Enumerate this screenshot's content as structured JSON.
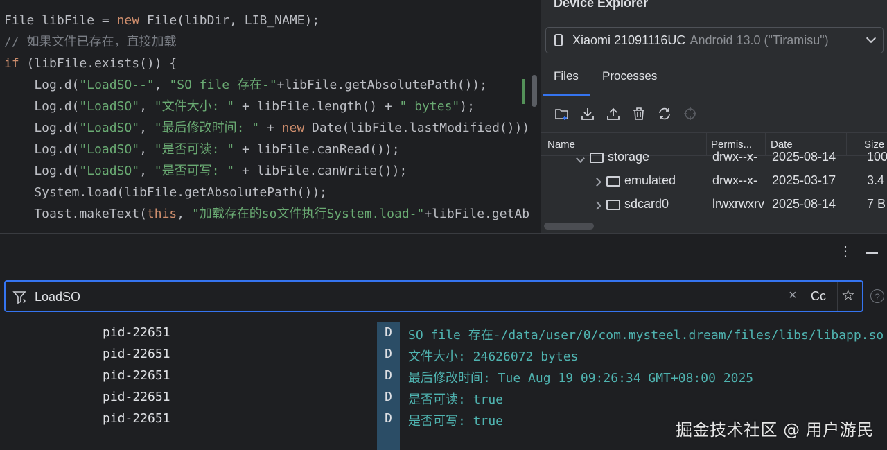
{
  "editor": {
    "lines": [
      [
        {
          "t": "File libFile = ",
          "c": "plain"
        },
        {
          "t": "new ",
          "c": "kw"
        },
        {
          "t": "File(libDir, LIB_NAME);",
          "c": "plain"
        }
      ],
      [
        {
          "t": "// 如果文件已存在，直接加载",
          "c": "cm"
        }
      ],
      [
        {
          "t": "if ",
          "c": "kw"
        },
        {
          "t": "(libFile.exists()) {",
          "c": "plain"
        }
      ],
      [
        {
          "t": "    Log.",
          "c": "plain"
        },
        {
          "t": "d",
          "c": "plain"
        },
        {
          "t": "(",
          "c": "plain"
        },
        {
          "t": "\"LoadSO--\"",
          "c": "str"
        },
        {
          "t": ", ",
          "c": "plain"
        },
        {
          "t": "\"SO file 存在-\"",
          "c": "str"
        },
        {
          "t": "+libFile.getAbsolutePath());",
          "c": "plain"
        }
      ],
      [
        {
          "t": "    Log.d(",
          "c": "plain"
        },
        {
          "t": "\"LoadSO\"",
          "c": "str"
        },
        {
          "t": ", ",
          "c": "plain"
        },
        {
          "t": "\"文件大小: \"",
          "c": "str"
        },
        {
          "t": " + libFile.length() + ",
          "c": "plain"
        },
        {
          "t": "\" bytes\"",
          "c": "str"
        },
        {
          "t": ");",
          "c": "plain"
        }
      ],
      [
        {
          "t": "    Log.d(",
          "c": "plain"
        },
        {
          "t": "\"LoadSO\"",
          "c": "str"
        },
        {
          "t": ", ",
          "c": "plain"
        },
        {
          "t": "\"最后修改时间: \"",
          "c": "str"
        },
        {
          "t": " + ",
          "c": "plain"
        },
        {
          "t": "new ",
          "c": "kw"
        },
        {
          "t": "Date(libFile.lastModified()))",
          "c": "plain"
        }
      ],
      [
        {
          "t": "    Log.d(",
          "c": "plain"
        },
        {
          "t": "\"LoadSO\"",
          "c": "str"
        },
        {
          "t": ", ",
          "c": "plain"
        },
        {
          "t": "\"是否可读: \"",
          "c": "str"
        },
        {
          "t": " + libFile.canRead());",
          "c": "plain"
        }
      ],
      [
        {
          "t": "    Log.d(",
          "c": "plain"
        },
        {
          "t": "\"LoadSO\"",
          "c": "str"
        },
        {
          "t": ", ",
          "c": "plain"
        },
        {
          "t": "\"是否可写: \"",
          "c": "str"
        },
        {
          "t": " + libFile.canWrite());",
          "c": "plain"
        }
      ],
      [
        {
          "t": "    System.load(libFile.getAbsolutePath());",
          "c": "plain"
        }
      ],
      [
        {
          "t": "    Toast.makeText(",
          "c": "plain"
        },
        {
          "t": "this",
          "c": "kw"
        },
        {
          "t": ", ",
          "c": "plain"
        },
        {
          "t": "\"加载存在的so文件执行System.load-\"",
          "c": "str"
        },
        {
          "t": "+libFile.getAb",
          "c": "plain"
        }
      ]
    ]
  },
  "device_explorer": {
    "title": "Device Explorer",
    "device_name": "Xiaomi 21091116UC",
    "device_version": "Android 13.0 (\"Tiramisu\")",
    "tabs": [
      "Files",
      "Processes"
    ],
    "active_tab": "Files",
    "toolbar_icons": [
      "new-folder-icon",
      "download-icon",
      "upload-icon",
      "delete-icon",
      "sync-icon",
      "locate-icon"
    ],
    "columns": [
      "Name",
      "Permis...",
      "Date",
      "Size"
    ],
    "rows": [
      {
        "name": "storage",
        "perm": "drwx--x-",
        "date": "2025-08-14",
        "size": "100",
        "expanded": true,
        "indent": 1
      },
      {
        "name": "emulated",
        "perm": "drwx--x-",
        "date": "2025-03-17",
        "size": "3.4 I",
        "expanded": false,
        "indent": 2
      },
      {
        "name": "sdcard0",
        "perm": "lrwxrwxrv",
        "date": "2025-08-14",
        "size": "7 B",
        "expanded": false,
        "indent": 2,
        "link": true
      }
    ]
  },
  "logcat": {
    "filter_value": "LoadSO",
    "match_case_label": "Cc",
    "help_label": "?",
    "rows": [
      {
        "pid": "pid-22651",
        "level": "D",
        "message": "SO file 存在-/data/user/0/com.mysteel.dream/files/libs/libapp.so"
      },
      {
        "pid": "pid-22651",
        "level": "D",
        "message": "文件大小: 24626072 bytes"
      },
      {
        "pid": "pid-22651",
        "level": "D",
        "message": "最后修改时间: Tue Aug 19 09:26:34 GMT+08:00 2025"
      },
      {
        "pid": "pid-22651",
        "level": "D",
        "message": "是否可读: true"
      },
      {
        "pid": "pid-22651",
        "level": "D",
        "message": "是否可写: true"
      }
    ]
  },
  "watermark": "掘金技术社区 @ 用户游民",
  "colors": {
    "accent": "#3574f0",
    "log_message": "#4fb3b0",
    "level_badge": "#2b4d66"
  }
}
